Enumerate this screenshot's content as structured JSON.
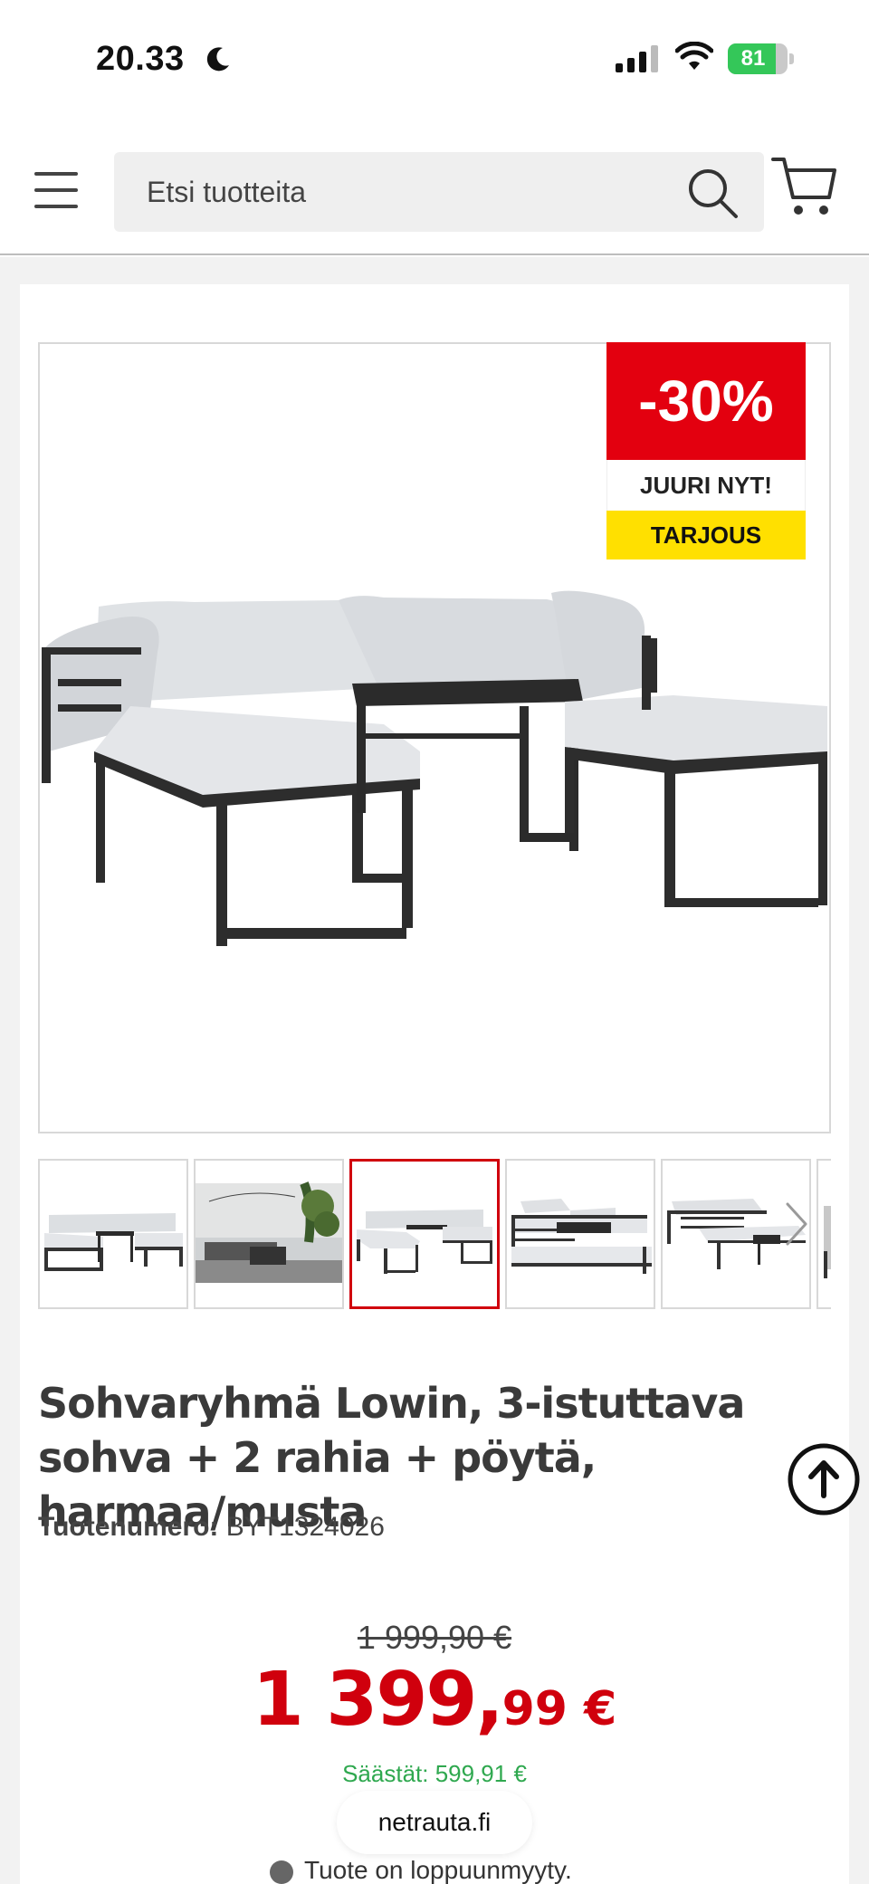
{
  "status_bar": {
    "time": "20.33",
    "battery": "81",
    "battery_level": 0.81
  },
  "header": {
    "search_placeholder": "Etsi tuotteita"
  },
  "product": {
    "discount_badge": {
      "percent": "-30%",
      "line1": "JUURI NYT!",
      "line2": "TARJOUS"
    },
    "thumbnail_count": 6,
    "active_thumbnail": 3,
    "title": "Sohvaryhmä Lowin, 3-istuttava sohva + 2 rahia + pöytä, harmaa/musta",
    "sku_label": "Tuotenumero:",
    "sku_value": "BYT1324026",
    "old_price": "1 999,90 €",
    "new_price_main": "1 399,",
    "new_price_cents": "99 €",
    "savings": "Säästät: 599,91 €",
    "stock_status": "Tuote on loppuunmyyty."
  },
  "browser": {
    "domain": "netrauta.fi"
  },
  "colors": {
    "accent_red": "#d0000d",
    "badge_yellow": "#ffe000",
    "savings_green": "#2fa84f",
    "battery_green": "#34c759"
  }
}
